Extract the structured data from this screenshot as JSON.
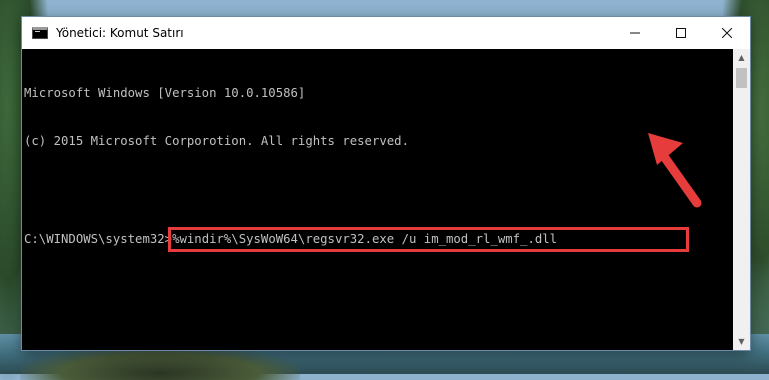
{
  "window": {
    "title": "Yönetici: Komut Satırı",
    "controls": {
      "minimize": "—",
      "maximize": "□",
      "close": "✕"
    }
  },
  "console": {
    "lines": [
      "Microsoft Windows [Version 10.0.10586]",
      "(c) 2015 Microsoft Corporotion. All rights reserved.",
      "",
      "C:\\WINDOWS\\system32>"
    ],
    "command": "%windir%\\SysWoW64\\regsvr32.exe /u im_mod_rl_wmf_.dll"
  },
  "scrollbar": {
    "up_glyph": "▲",
    "down_glyph": "▼"
  },
  "annotation": {
    "highlight_color": "#e63c3c",
    "arrow_icon": "arrow-pointing-up-left"
  }
}
